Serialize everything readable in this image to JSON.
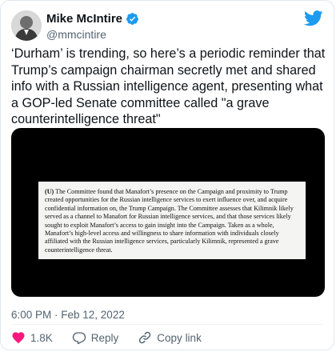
{
  "author": {
    "display_name": "Mike McIntire",
    "handle": "@mmcintire",
    "verified": true
  },
  "tweet": {
    "text": "‘Durham’ is trending, so here’s a periodic reminder that Trump’s campaign chairman secretly met and shared info with a Russian intelligence agent, presenting what a GOP-led Senate committee called \"a grave counterintelligence threat\"",
    "timestamp": "6:00 PM · Feb 12, 2022"
  },
  "media": {
    "document_lead": "(U)",
    "document_text": "The Committee found that Manafort’s presence on the Campaign and proximity to Trump created opportunities for the Russian intelligence services to exert influence over, and acquire confidential information on, the Trump Campaign. The Committee assesses that Kilimnik likely served as a channel to Manafort for Russian intelligence services, and that those services likely sought to exploit Manafort’s access to gain insight into the Campaign. Taken as a whole, Manafort’s high-level access and willingness to share information with individuals closely affiliated with the Russian intelligence services, particularly Kilimnik, represented a grave counterintelligence threat."
  },
  "actions": {
    "likes": "1.8K",
    "reply_label": "Reply",
    "copy_link_label": "Copy link"
  },
  "icons": {
    "brand": "twitter-bird-icon",
    "verified": "verified-badge-icon",
    "like": "heart-icon",
    "reply": "reply-icon",
    "copy": "link-icon"
  },
  "colors": {
    "brand_blue": "#1d9bf0",
    "text_primary": "#0f1419",
    "text_secondary": "#536471",
    "like_red": "#f91880"
  }
}
